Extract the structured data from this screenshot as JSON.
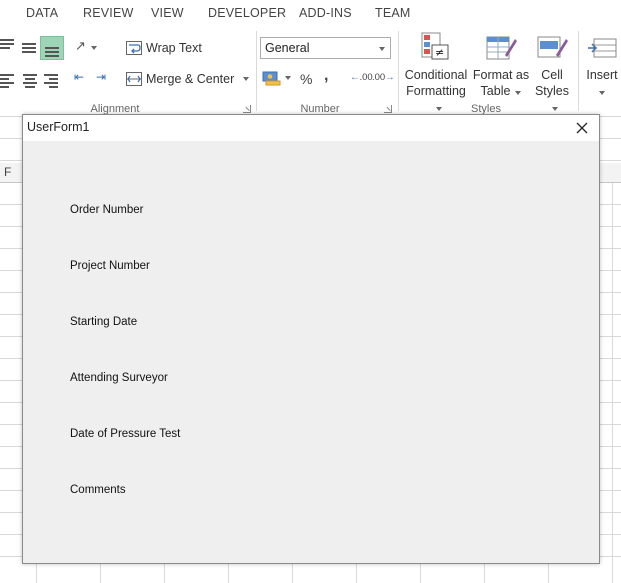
{
  "menu": {
    "tabs": [
      "DATA",
      "REVIEW",
      "VIEW",
      "DEVELOPER",
      "ADD-INS",
      "TEAM"
    ]
  },
  "ribbon": {
    "alignment": {
      "group_label": "Alignment",
      "wrap_text_label": "Wrap Text",
      "merge_center_label": "Merge & Center"
    },
    "number": {
      "group_label": "Number",
      "format_value": "General",
      "percent_symbol": "%",
      "comma_symbol": ",",
      "increase_decimal_label": ".00",
      "decrease_decimal_label": ".00"
    },
    "styles": {
      "group_label": "Styles",
      "conditional_formatting": [
        "Conditional",
        "Formatting"
      ],
      "format_as_table": [
        "Format as",
        "Table"
      ],
      "cell_styles": [
        "Cell",
        "Styles"
      ]
    },
    "cells": {
      "insert_label": "Insert"
    }
  },
  "sheet": {
    "visible_column": "F"
  },
  "userform": {
    "title": "UserForm1",
    "labels": [
      "Order Number",
      "Project Number",
      "Starting Date",
      "Attending Surveyor",
      "Date of Pressure Test",
      "Comments"
    ]
  },
  "colors": {
    "form_background": "#efefef",
    "selected_alignment": "#9fd5b7",
    "ribbon_background": "#ffffff"
  }
}
